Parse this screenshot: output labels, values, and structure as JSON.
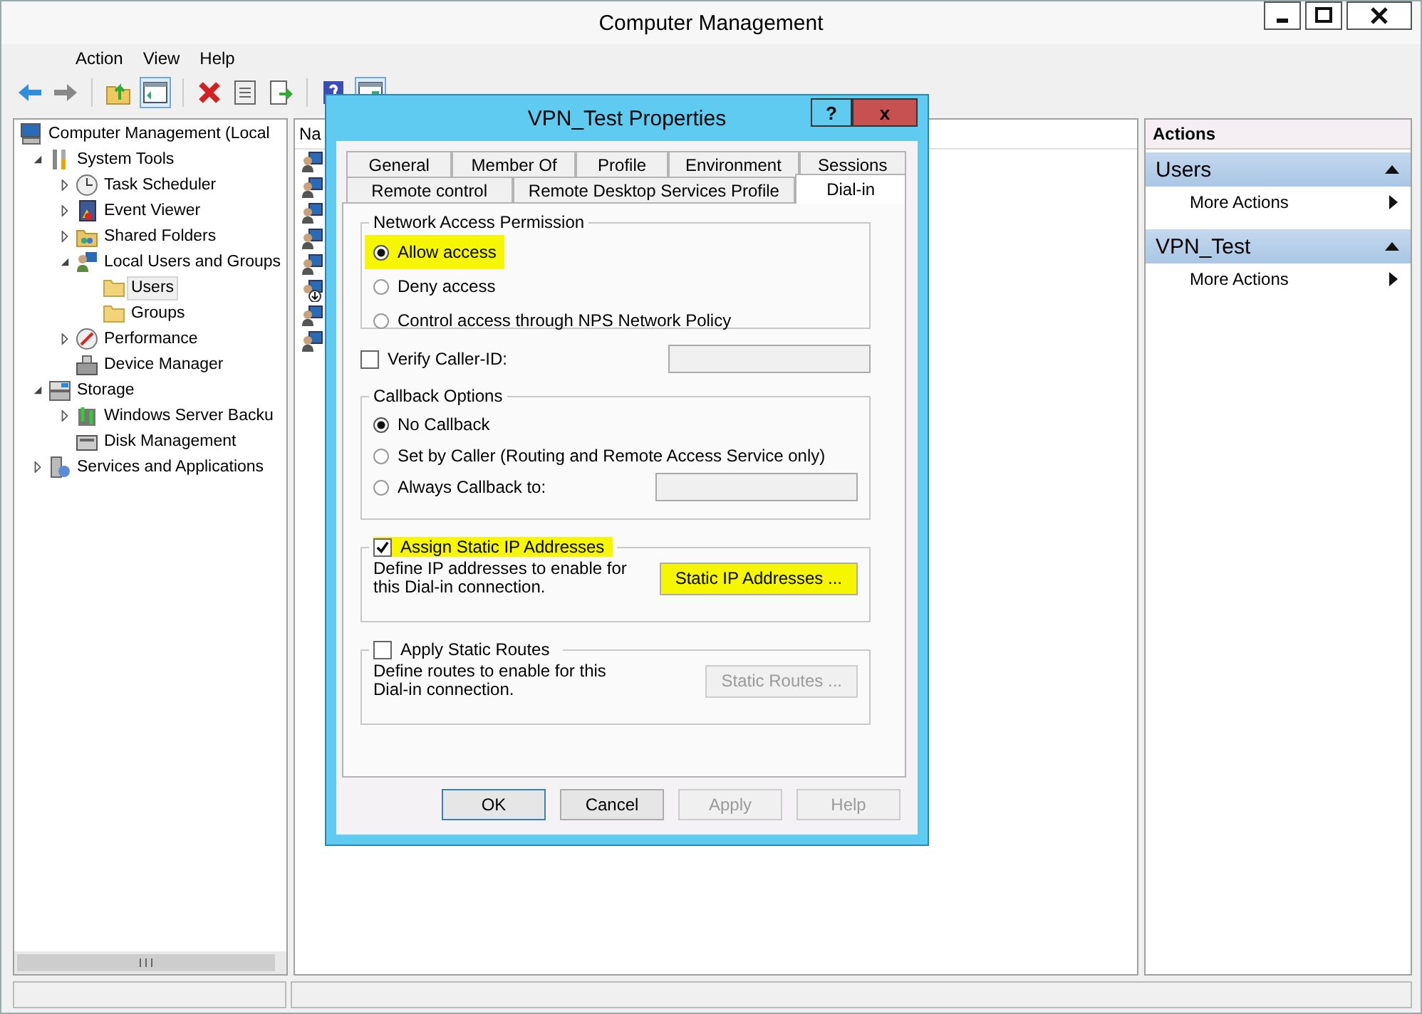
{
  "window": {
    "title": "Computer Management"
  },
  "menu": [
    "Action",
    "View",
    "Help"
  ],
  "tree": [
    {
      "label": "Computer Management (Local",
      "kind": "computer",
      "selected": false,
      "children": [
        {
          "label": "System Tools",
          "kind": "tools",
          "expanded": true,
          "selected": false,
          "children": [
            {
              "label": "Task Scheduler",
              "kind": "clock",
              "expanded": false,
              "selected": false
            },
            {
              "label": "Event Viewer",
              "kind": "log",
              "expanded": false,
              "selected": false
            },
            {
              "label": "Shared Folders",
              "kind": "share",
              "expanded": false,
              "selected": false
            },
            {
              "label": "Local Users and Groups",
              "kind": "users",
              "expanded": true,
              "selected": false,
              "children": [
                {
                  "label": "Users",
                  "kind": "folder",
                  "selected": true
                },
                {
                  "label": "Groups",
                  "kind": "folder",
                  "selected": false
                }
              ]
            },
            {
              "label": "Performance",
              "kind": "gauge",
              "expanded": false,
              "selected": false
            },
            {
              "label": "Device Manager",
              "kind": "device",
              "selected": false
            }
          ]
        },
        {
          "label": "Storage",
          "kind": "storage",
          "expanded": true,
          "selected": false,
          "children": [
            {
              "label": "Windows Server Backu",
              "kind": "backup",
              "expanded": false,
              "selected": false
            },
            {
              "label": "Disk Management",
              "kind": "disk",
              "selected": false
            }
          ]
        },
        {
          "label": "Services and Applications",
          "kind": "services",
          "expanded": false,
          "selected": false
        }
      ]
    }
  ],
  "list": {
    "column": "Na",
    "rows": [
      {
        "kind": "user"
      },
      {
        "kind": "user"
      },
      {
        "kind": "user"
      },
      {
        "kind": "user"
      },
      {
        "kind": "user"
      },
      {
        "kind": "disabled-user"
      },
      {
        "kind": "user"
      },
      {
        "kind": "user"
      }
    ]
  },
  "actions": {
    "title": "Actions",
    "sections": [
      {
        "title": "Users",
        "items": [
          "More Actions"
        ]
      },
      {
        "title": "VPN_Test",
        "items": [
          "More Actions"
        ]
      }
    ]
  },
  "dialog": {
    "title": "VPN_Test Properties",
    "help_button": "?",
    "close_button": "x",
    "tab_rows": [
      [
        {
          "label": "General",
          "selected": false
        },
        {
          "label": "Member Of",
          "selected": false
        },
        {
          "label": "Profile",
          "selected": false
        },
        {
          "label": "Environment",
          "selected": false
        },
        {
          "label": "Sessions",
          "selected": false
        }
      ],
      [
        {
          "label": "Remote control",
          "selected": false
        },
        {
          "label": "Remote Desktop Services Profile",
          "selected": false
        },
        {
          "label": "Dial-in",
          "selected": true
        }
      ]
    ],
    "access": {
      "title": "Network Access Permission",
      "options": [
        {
          "label": "Allow access",
          "selected": true,
          "highlighted": true
        },
        {
          "label": "Deny access",
          "selected": false,
          "highlighted": false
        },
        {
          "label": "Control access through NPS Network Policy",
          "selected": false,
          "highlighted": false
        }
      ]
    },
    "verify_caller": {
      "label": "Verify Caller-ID:",
      "checked": false
    },
    "callback": {
      "title": "Callback Options",
      "options": [
        {
          "label": "No Callback",
          "selected": true,
          "field": false
        },
        {
          "label": "Set by Caller (Routing and Remote Access Service only)",
          "selected": false,
          "field": false
        },
        {
          "label": "Always Callback to:",
          "selected": false,
          "field": true
        }
      ]
    },
    "static_ip": {
      "label": "Assign Static IP Addresses",
      "checked": true,
      "highlighted": true,
      "text": "Define IP addresses to enable for this Dial-in connection.",
      "button": "Static IP Addresses ...",
      "button_disabled": false,
      "button_highlighted": true
    },
    "static_routes": {
      "label": "Apply Static Routes",
      "checked": false,
      "highlighted": false,
      "text": "Define routes to enable for this Dial-in connection.",
      "button": "Static Routes ...",
      "button_disabled": true,
      "button_highlighted": false
    },
    "buttons": [
      {
        "label": "OK",
        "disabled": false,
        "default": true
      },
      {
        "label": "Cancel",
        "disabled": false,
        "default": false
      },
      {
        "label": "Apply",
        "disabled": true,
        "default": false
      },
      {
        "label": "Help",
        "disabled": true,
        "default": false
      }
    ]
  }
}
